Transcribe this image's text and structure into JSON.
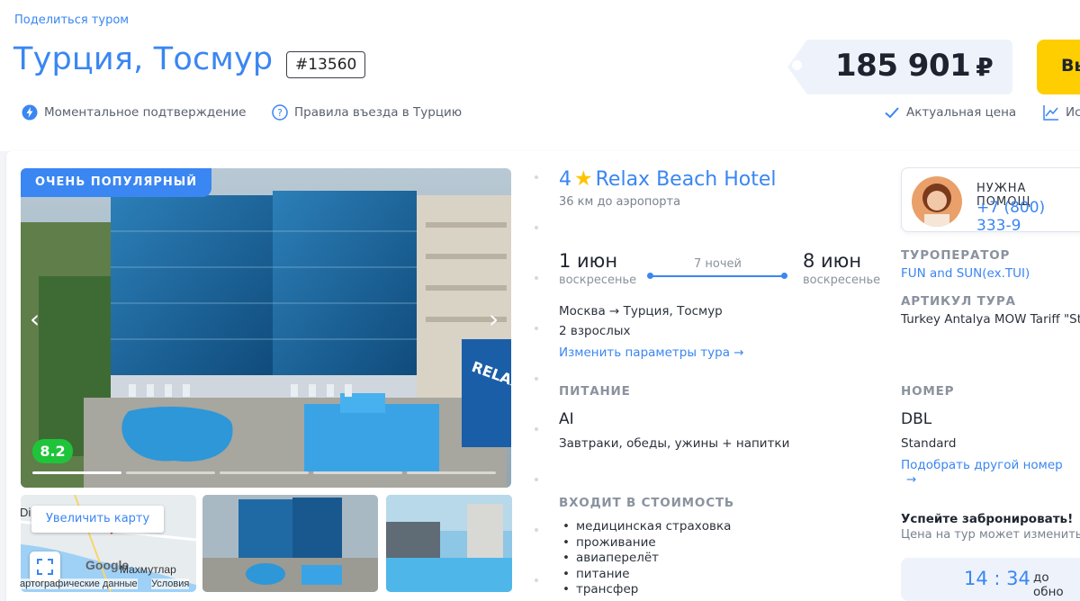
{
  "header": {
    "share_link": "Поделиться туром",
    "title": "Турция, Тосмур",
    "tour_id": "#13560",
    "features": [
      {
        "label": "Моментальное подтверждение",
        "icon": "lightning-icon"
      },
      {
        "label": "Правила въезда в Турцию",
        "icon": "question-icon"
      },
      {
        "label": "Актуальная цена",
        "icon": "check-icon"
      },
      {
        "label": "Ис",
        "icon": "chart-icon"
      }
    ],
    "price": "185 901",
    "currency": "₽",
    "buy_label": "Вы"
  },
  "gallery": {
    "badge": "ОЧЕНЬ ПОПУЛЯРНЫЙ",
    "rating": "8.2",
    "slides_total": 5,
    "active_slide": 1,
    "map_button": "Увеличить карту",
    "map_labels": {
      "city": "Махмутлар",
      "brand": "Google",
      "credits": "артографические данные",
      "terms": "Условия",
      "corner": "Di"
    }
  },
  "hotel": {
    "stars": "4",
    "name": "Relax Beach Hotel",
    "distance": "36 км до аэропорта"
  },
  "dates": {
    "start_date": "1 июн",
    "start_day": "воскресенье",
    "nights": "7 ночей",
    "end_date": "8 июн",
    "end_day": "воскресенье"
  },
  "trip": {
    "route": "Москва → Турция, Тосмур",
    "guests": "2 взрослых",
    "change_link": "Изменить параметры тура"
  },
  "meal": {
    "label": "ПИТАНИЕ",
    "code": "AI",
    "description": "Завтраки, обеды, ужины + напитки"
  },
  "included": {
    "label": "ВХОДИТ В СТОИМОСТЬ",
    "items": [
      "медицинская страховка",
      "проживание",
      "авиаперелёт",
      "питание",
      "трансфер"
    ]
  },
  "help": {
    "title": "НУЖНА ПОМОЩ",
    "phone": "+7 (800) 333-9"
  },
  "operator": {
    "label": "ТУРОПЕРАТОР",
    "value": "FUN and SUN(ex.TUI)"
  },
  "article": {
    "label": "АРТИКУЛ ТУРА",
    "value": "Turkey Antalya MOW Tariff \"Stan"
  },
  "room": {
    "label": "НОМЕР",
    "code": "DBL",
    "type": "Standard",
    "change_link": "Подобрать другой номер"
  },
  "booking": {
    "title": "Успейте забронировать!",
    "subtitle": "Цена на тур может измениться",
    "timer": "14 : 34",
    "timer_suffix": "до обно"
  },
  "colors": {
    "accent": "#3a86f2",
    "buy": "#ffce00",
    "rating": "#1fc43a",
    "star": "#ffc400"
  }
}
